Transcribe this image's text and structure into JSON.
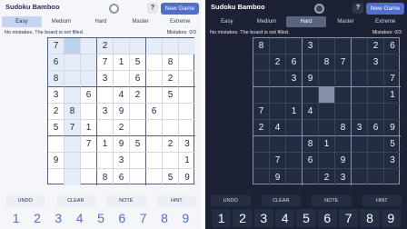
{
  "app": {
    "title": "Sudoku Bamboo",
    "help_label": "?",
    "new_game_label": "New Game"
  },
  "difficulties": [
    "Easy",
    "Medium",
    "Hard",
    "Master",
    "Extreme"
  ],
  "status": "No mistakes. The board is not filled.",
  "mistakes": "Mistakes: 0/3",
  "tools": [
    "UNDO",
    "CLEAR",
    "NOTE",
    "HINT"
  ],
  "numbers": [
    "1",
    "2",
    "3",
    "4",
    "5",
    "6",
    "7",
    "8",
    "9"
  ],
  "light": {
    "active_difficulty": "Easy",
    "selected": [
      0,
      1
    ],
    "board": [
      [
        "7",
        "",
        "",
        "2",
        "",
        "",
        "",
        "",
        ""
      ],
      [
        "6",
        "",
        "",
        "7",
        "1",
        "5",
        "",
        "8",
        ""
      ],
      [
        "8",
        "",
        "",
        "3",
        "",
        "6",
        "",
        "2",
        ""
      ],
      [
        "3",
        "",
        "6",
        "",
        "4",
        "2",
        "",
        "5",
        ""
      ],
      [
        "2",
        "8",
        "",
        "3",
        "9",
        "",
        "6",
        "",
        ""
      ],
      [
        "5",
        "7",
        "1",
        "",
        "2",
        "",
        "",
        "",
        ""
      ],
      [
        "",
        "",
        "7",
        "1",
        "9",
        "5",
        "",
        "2",
        "3"
      ],
      [
        "9",
        "",
        "",
        "",
        "3",
        "",
        "",
        "",
        "1"
      ],
      [
        "",
        "",
        "",
        "8",
        "6",
        "",
        "",
        "5",
        "9"
      ]
    ]
  },
  "dark": {
    "active_difficulty": "Hard",
    "selected": [
      3,
      4
    ],
    "board": [
      [
        "8",
        "",
        "",
        "3",
        "",
        "",
        "",
        "2",
        "6"
      ],
      [
        "",
        "2",
        "6",
        "",
        "8",
        "7",
        "",
        "3",
        ""
      ],
      [
        "",
        "",
        "3",
        "9",
        "",
        "",
        "",
        "",
        "7"
      ],
      [
        "",
        "",
        "",
        "",
        "",
        "",
        "",
        "",
        "1"
      ],
      [
        "7",
        "",
        "1",
        "4",
        "",
        "",
        "",
        "",
        ""
      ],
      [
        "2",
        "4",
        "",
        "",
        "",
        "8",
        "3",
        "6",
        "9"
      ],
      [
        "",
        "",
        "",
        "8",
        "1",
        "",
        "",
        "",
        "5"
      ],
      [
        "",
        "7",
        "",
        "6",
        "",
        "9",
        "",
        "",
        "3"
      ],
      [
        "",
        "9",
        "",
        "",
        "2",
        "3",
        "",
        "",
        ""
      ]
    ]
  },
  "colors": {
    "accent": "#4f6ecf",
    "light_background": "#f5f6fa",
    "dark_background": "#1c2233"
  }
}
